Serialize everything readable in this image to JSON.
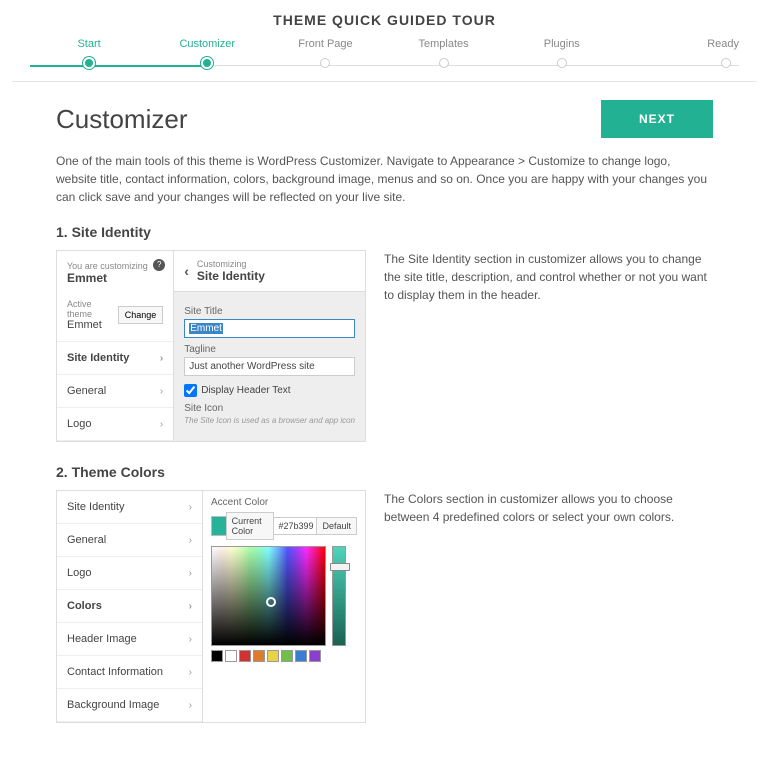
{
  "header": {
    "title": "THEME QUICK GUIDED TOUR"
  },
  "steps": [
    "Start",
    "Customizer",
    "Front Page",
    "Templates",
    "Plugins",
    "Ready"
  ],
  "page": {
    "title": "Customizer",
    "next": "NEXT",
    "intro": "One of the main tools of this theme is WordPress Customizer. Navigate to Appearance > Customize to change logo, website title, contact information, colors, background image, menus and so on. Once you are happy with your changes you can click save and your changes will be reflected on your live site."
  },
  "section1": {
    "heading": "1. Site Identity",
    "desc": "The Site Identity section in customizer allows you to change the site title, description, and control whether or not you want to display them in the header.",
    "customizer": {
      "youare": "You are customizing",
      "siteName": "Emmet",
      "activeTheme": "Active theme",
      "themeName": "Emmet",
      "change": "Change",
      "menu": [
        "Site Identity",
        "General",
        "Logo"
      ],
      "panelLabel": "Customizing",
      "panelTitle": "Site Identity",
      "fields": {
        "titleLbl": "Site Title",
        "titleVal": "Emmet",
        "tagLbl": "Tagline",
        "tagVal": "Just another WordPress site",
        "chkLbl": "Display Header Text",
        "iconLbl": "Site Icon",
        "iconNote": "The Site Icon is used as a browser and app icon"
      }
    }
  },
  "section2": {
    "heading": "2. Theme Colors",
    "desc": "The Colors section in customizer allows you to choose between 4 predefined colors or select your own colors.",
    "menu": [
      "Site Identity",
      "General",
      "Logo",
      "Colors",
      "Header Image",
      "Contact Information",
      "Background Image"
    ],
    "accent": {
      "label": "Accent Color",
      "current": "Current Color",
      "hex": "#27b399",
      "default": "Default"
    },
    "palette": [
      "#000000",
      "#ffffff",
      "#d33131",
      "#e07b28",
      "#e8d245",
      "#6fbf4a",
      "#3a7ed4",
      "#8a3fd0"
    ]
  }
}
